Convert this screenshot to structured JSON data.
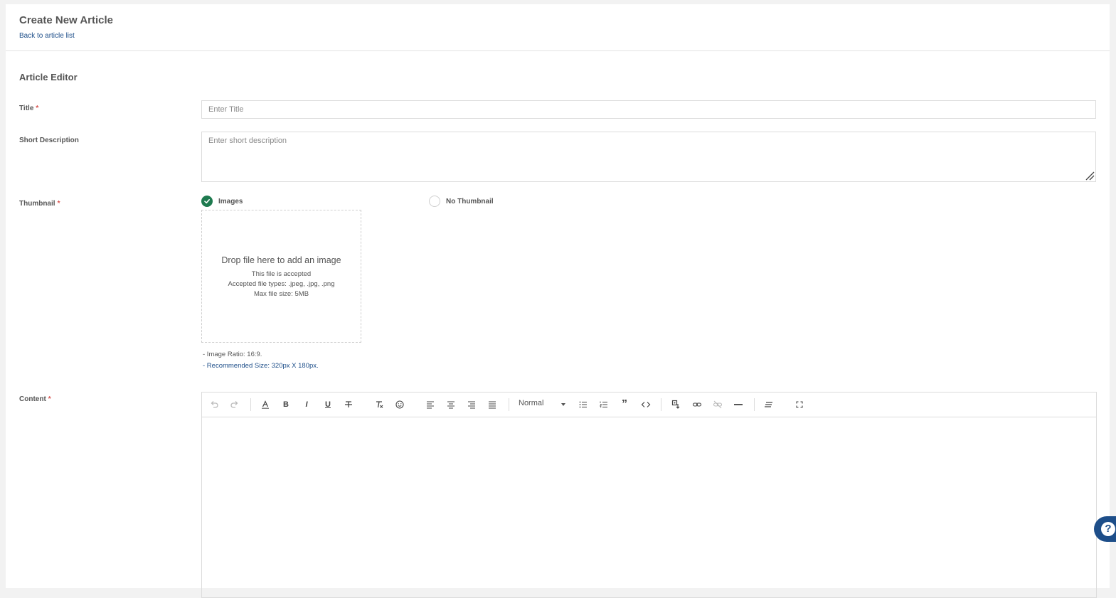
{
  "header": {
    "title": "Create New Article",
    "back_link": "Back to article list"
  },
  "editor_section": {
    "title": "Article Editor"
  },
  "fields": {
    "title": {
      "label": "Title",
      "required_mark": "*",
      "placeholder": "Enter Title",
      "value": ""
    },
    "short_description": {
      "label": "Short Description",
      "placeholder": "Enter short description",
      "value": ""
    },
    "thumbnail": {
      "label": "Thumbnail",
      "required_mark": "*",
      "options": [
        {
          "label": "Images",
          "checked": true
        },
        {
          "label": "No Thumbnail",
          "checked": false
        }
      ],
      "dropzone": {
        "title": "Drop file here to add an image",
        "accepted": "This file is accepted",
        "types": "Accepted file types: .jpeg, .jpg, .png",
        "max_size": "Max file size: 5MB"
      },
      "hints": {
        "ratio": "- Image Ratio: 16:9.",
        "recommended": "- Recommended Size: 320px X 180px."
      }
    },
    "content": {
      "label": "Content",
      "required_mark": "*",
      "toolbar": {
        "format_value": "Normal",
        "icons": [
          "undo-icon",
          "redo-icon",
          "font-color-icon",
          "bold-icon",
          "italic-icon",
          "underline-icon",
          "strikethrough-icon",
          "clear-format-icon",
          "emoji-icon",
          "align-left-icon",
          "align-center-icon",
          "align-right-icon",
          "align-justify-icon",
          "bullet-list-icon",
          "numbered-list-icon",
          "blockquote-icon",
          "code-icon",
          "image-icon",
          "link-icon",
          "unlink-icon",
          "horizontal-rule-icon",
          "line-height-icon",
          "fullscreen-icon"
        ],
        "bold_glyph": "B",
        "italic_glyph": "I",
        "underline_glyph": "U",
        "quote_glyph": "”"
      }
    }
  },
  "help": {
    "glyph": "?"
  },
  "colors": {
    "accent_green": "#1e7a4f",
    "link_blue": "#1d4e89",
    "required_red": "#d9534f"
  }
}
